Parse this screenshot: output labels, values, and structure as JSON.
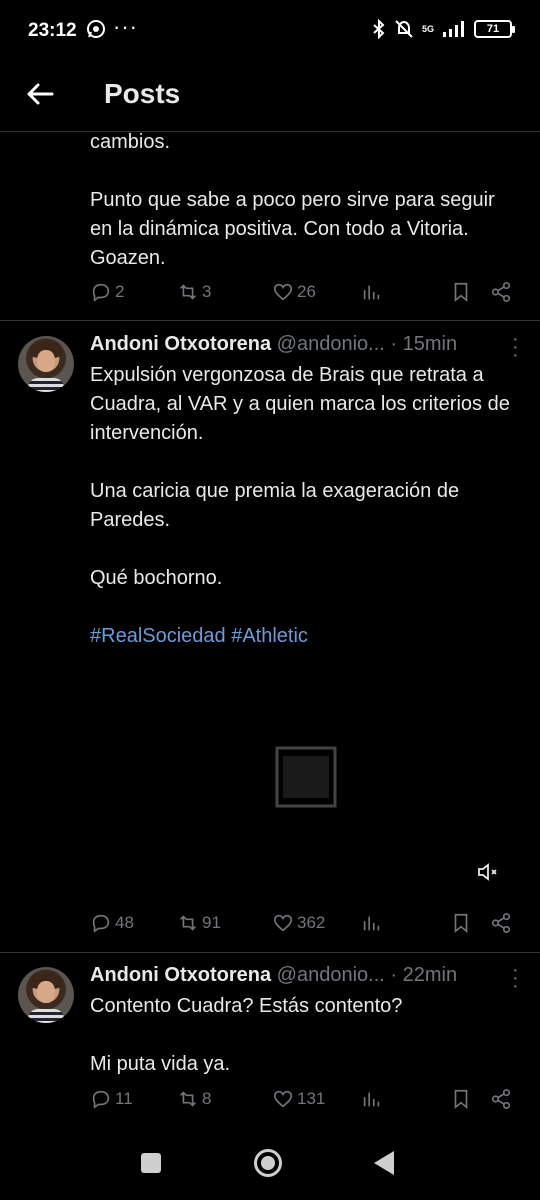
{
  "status_bar": {
    "time": "23:12",
    "dots": "···",
    "network": "5G",
    "battery": "71"
  },
  "header": {
    "title": "Posts"
  },
  "prev_post": {
    "paragraphs": [
      "cambios.",
      "Punto que sabe a poco pero sirve para seguir en la dinámica positiva. Con todo a Vitoria. Goazen."
    ],
    "replies": "2",
    "reposts": "3",
    "likes": "26"
  },
  "posts": [
    {
      "name": "Andoni Otxotorena",
      "handle": "@andonio...",
      "time": "· 15min",
      "paragraphs": [
        "Expulsión vergonzosa de Brais que retrata a Cuadra, al VAR y a quien marca los criterios de intervención.",
        "Una caricia que premia la exageración de Paredes.",
        "Qué bochorno."
      ],
      "hashtags": "#RealSociedad #Athletic",
      "replies": "48",
      "reposts": "91",
      "likes": "362"
    },
    {
      "name": "Andoni Otxotorena",
      "handle": "@andonio...",
      "time": "· 22min",
      "paragraphs": [
        "Contento Cuadra? Estás contento?",
        "Mi puta vida ya."
      ],
      "replies": "11",
      "reposts": "8",
      "likes": "131"
    }
  ],
  "icons": [
    "back-arrow-icon",
    "reply-icon",
    "repost-icon",
    "like-icon",
    "views-icon",
    "bookmark-icon",
    "share-icon",
    "mute-icon",
    "more-icon"
  ]
}
